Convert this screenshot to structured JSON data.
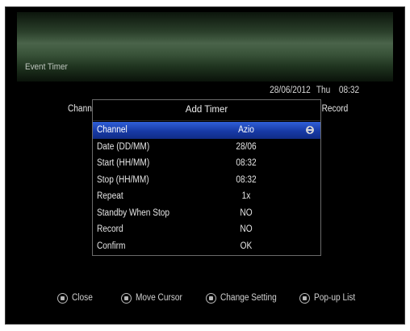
{
  "window": {
    "title": "Event Timer"
  },
  "datetime": {
    "date": "28/06/2012",
    "day": "Thu",
    "time": "08:32"
  },
  "background_columns": {
    "left": "Chann",
    "right": "t Record"
  },
  "dialog": {
    "title": "Add Timer",
    "rows": [
      {
        "label": "Channel",
        "value": "Azio",
        "selected": true
      },
      {
        "label": "Date (DD/MM)",
        "value": "28/06"
      },
      {
        "label": "Start (HH/MM)",
        "value": "08:32"
      },
      {
        "label": "Stop (HH/MM)",
        "value": "08:32"
      },
      {
        "label": "Repeat",
        "value": "1x"
      },
      {
        "label": "Standby When Stop",
        "value": "NO"
      },
      {
        "label": "Record",
        "value": "NO"
      },
      {
        "label": "Confirm",
        "value": "OK"
      }
    ]
  },
  "footer": {
    "hints": [
      {
        "label": "Close",
        "icon": "exit-key-icon"
      },
      {
        "label": "Move Cursor",
        "icon": "up-down-key-icon"
      },
      {
        "label": "Change Setting",
        "icon": "left-right-key-icon"
      },
      {
        "label": "Pop-up List",
        "icon": "ok-key-icon"
      }
    ]
  },
  "colors": {
    "selection": "#1f44b8",
    "header_band": "#4a644a"
  }
}
